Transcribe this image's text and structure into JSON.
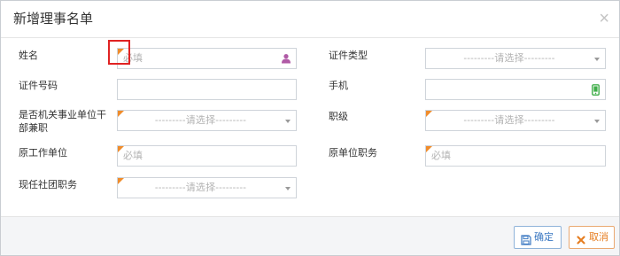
{
  "dialog": {
    "title": "新增理事名单",
    "close_icon": "close-icon"
  },
  "form": {
    "name": {
      "label": "姓名",
      "placeholder": "必填",
      "icon": "person-icon",
      "required": true
    },
    "id_type": {
      "label": "证件类型",
      "value": "---------请选择---------",
      "required": false
    },
    "id_number": {
      "label": "证件号码",
      "value": "",
      "required": false
    },
    "phone": {
      "label": "手机",
      "value": "",
      "icon": "mobile-phone-icon",
      "required": false
    },
    "part_time": {
      "label_line1": "是否机关事业单位干",
      "label_line2": "部兼职",
      "value": "---------请选择---------",
      "required": true
    },
    "rank": {
      "label": "职级",
      "value": "---------请选择---------",
      "required": true
    },
    "former_unit": {
      "label": "原工作单位",
      "placeholder": "必填",
      "required": true
    },
    "former_position": {
      "label": "原单位职务",
      "placeholder": "必填",
      "required": true
    },
    "current_position": {
      "label": "现任社团职务",
      "value": "---------请选择---------",
      "required": true
    }
  },
  "footer": {
    "confirm_label": "确定",
    "cancel_label": "取消"
  },
  "colors": {
    "required_marker": "#f08c2b",
    "highlight": "#e02323",
    "confirm": "#3b78c2",
    "cancel": "#e67e22",
    "person_icon": "#b05aa6",
    "phone_icon": "#3fae49"
  }
}
